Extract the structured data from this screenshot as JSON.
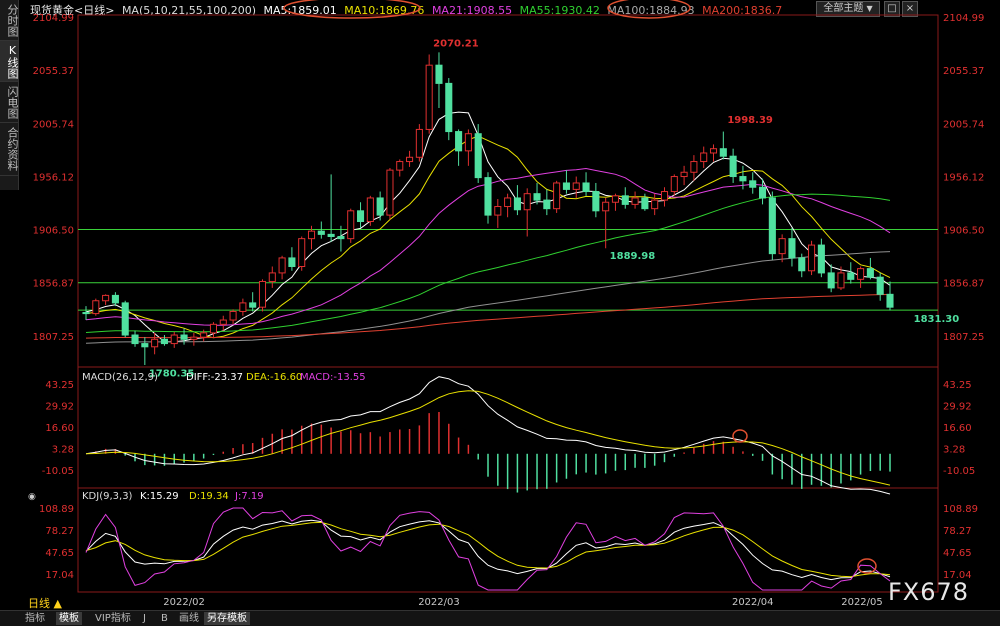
{
  "left_tabs": [
    "分时图",
    "K线图",
    "闪电图",
    "合约资料"
  ],
  "header": {
    "symbol": "现货黄金<日线>",
    "ma_label": "MA(5,10,21,55,100,200)",
    "ma5": "MA5:1859.01",
    "ma10": "MA10:1869.76",
    "ma21": "MA21:1908.55",
    "ma55": "MA55:1930.42",
    "ma100": "MA100:1884.93",
    "ma200": "MA200:1836.7",
    "settings_button": "全部主题",
    "dropdown_glyph": "▼",
    "close_glyph": "□",
    "pin_glyph": "×"
  },
  "colors": {
    "up": "#e03030",
    "down": "#50e0a0",
    "ma5": "#ffffff",
    "ma10": "#e8e000",
    "ma21": "#e040e0",
    "ma55": "#30d030",
    "ma100": "#909090",
    "ma200": "#e04030",
    "axis": "#e03030"
  },
  "price_axis": [
    "2104.99",
    "2055.37",
    "2005.74",
    "1956.12",
    "1906.50",
    "1856.87",
    "1807.25"
  ],
  "annotations": [
    "2070.21",
    "1998.39",
    "1889.98",
    "1831.30",
    "1780.35"
  ],
  "macd": {
    "title": "MACD(26,12,9)",
    "diff": "DIFF:-23.37",
    "dea": "DEA:-16.60",
    "macd": "MACD:-13.55",
    "axis": [
      "43.25",
      "29.92",
      "16.60",
      "3.28",
      "-10.05"
    ]
  },
  "kdj": {
    "title": "KDJ(9,3,3)",
    "k": "K:15.29",
    "d": "D:19.34",
    "j": "J:7.19",
    "axis": [
      "108.89",
      "78.27",
      "47.65",
      "17.04"
    ]
  },
  "time_axis": [
    "2022/02",
    "2022/03",
    "2022/04",
    "2022/05"
  ],
  "period_label": "日线 ▲",
  "bottom_tabs": [
    "指标",
    "模板",
    "VIP指标",
    "J",
    "B",
    "画线",
    "另存模板"
  ],
  "watermark": "FX678",
  "chart_data": {
    "type": "candlestick",
    "ohlc": [
      [
        1829,
        1835,
        1822,
        1828
      ],
      [
        1828,
        1842,
        1826,
        1840
      ],
      [
        1840,
        1846,
        1836,
        1845
      ],
      [
        1845,
        1848,
        1835,
        1838
      ],
      [
        1838,
        1840,
        1806,
        1808
      ],
      [
        1808,
        1812,
        1797,
        1800
      ],
      [
        1800,
        1806,
        1780,
        1797
      ],
      [
        1797,
        1810,
        1790,
        1804
      ],
      [
        1804,
        1808,
        1798,
        1800
      ],
      [
        1800,
        1811,
        1796,
        1808
      ],
      [
        1808,
        1814,
        1799,
        1804
      ],
      [
        1804,
        1810,
        1798,
        1806
      ],
      [
        1806,
        1813,
        1802,
        1810
      ],
      [
        1810,
        1820,
        1806,
        1818
      ],
      [
        1818,
        1826,
        1812,
        1822
      ],
      [
        1822,
        1832,
        1818,
        1830
      ],
      [
        1830,
        1842,
        1826,
        1838
      ],
      [
        1838,
        1848,
        1830,
        1834
      ],
      [
        1834,
        1860,
        1830,
        1858
      ],
      [
        1858,
        1872,
        1852,
        1866
      ],
      [
        1866,
        1882,
        1860,
        1880
      ],
      [
        1880,
        1890,
        1868,
        1872
      ],
      [
        1872,
        1900,
        1868,
        1898
      ],
      [
        1898,
        1910,
        1888,
        1905
      ],
      [
        1905,
        1914,
        1898,
        1902
      ],
      [
        1902,
        1958,
        1895,
        1900
      ],
      [
        1900,
        1910,
        1886,
        1898
      ],
      [
        1898,
        1926,
        1894,
        1924
      ],
      [
        1924,
        1932,
        1908,
        1914
      ],
      [
        1914,
        1938,
        1910,
        1936
      ],
      [
        1936,
        1942,
        1915,
        1920
      ],
      [
        1920,
        1964,
        1916,
        1962
      ],
      [
        1962,
        1972,
        1956,
        1970
      ],
      [
        1970,
        1980,
        1965,
        1974
      ],
      [
        1974,
        2005,
        1970,
        2000
      ],
      [
        2000,
        2070,
        1996,
        2060
      ],
      [
        2060,
        2072,
        2020,
        2043
      ],
      [
        2043,
        2048,
        1990,
        1998
      ],
      [
        1998,
        2000,
        1966,
        1980
      ],
      [
        1980,
        2000,
        1966,
        1996
      ],
      [
        1996,
        2005,
        1950,
        1955
      ],
      [
        1955,
        1960,
        1912,
        1920
      ],
      [
        1920,
        1935,
        1908,
        1928
      ],
      [
        1928,
        1940,
        1918,
        1936
      ],
      [
        1936,
        1948,
        1920,
        1925
      ],
      [
        1925,
        1945,
        1900,
        1940
      ],
      [
        1940,
        1950,
        1930,
        1934
      ],
      [
        1934,
        1944,
        1920,
        1926
      ],
      [
        1926,
        1952,
        1922,
        1950
      ],
      [
        1950,
        1962,
        1940,
        1944
      ],
      [
        1944,
        1956,
        1936,
        1950
      ],
      [
        1950,
        1960,
        1938,
        1942
      ],
      [
        1942,
        1950,
        1918,
        1924
      ],
      [
        1924,
        1936,
        1889,
        1932
      ],
      [
        1932,
        1940,
        1924,
        1938
      ],
      [
        1938,
        1946,
        1926,
        1930
      ],
      [
        1930,
        1942,
        1926,
        1936
      ],
      [
        1936,
        1940,
        1924,
        1926
      ],
      [
        1926,
        1940,
        1920,
        1934
      ],
      [
        1934,
        1946,
        1928,
        1942
      ],
      [
        1942,
        1958,
        1938,
        1956
      ],
      [
        1956,
        1966,
        1948,
        1960
      ],
      [
        1960,
        1976,
        1952,
        1970
      ],
      [
        1970,
        1984,
        1964,
        1978
      ],
      [
        1978,
        1986,
        1970,
        1982
      ],
      [
        1982,
        1998,
        1972,
        1975
      ],
      [
        1975,
        1982,
        1950,
        1956
      ],
      [
        1956,
        1966,
        1944,
        1952
      ],
      [
        1952,
        1960,
        1940,
        1946
      ],
      [
        1946,
        1954,
        1930,
        1936
      ],
      [
        1936,
        1942,
        1878,
        1884
      ],
      [
        1884,
        1902,
        1876,
        1898
      ],
      [
        1898,
        1908,
        1872,
        1880
      ],
      [
        1880,
        1884,
        1862,
        1868
      ],
      [
        1868,
        1896,
        1864,
        1892
      ],
      [
        1892,
        1898,
        1862,
        1866
      ],
      [
        1866,
        1874,
        1848,
        1852
      ],
      [
        1852,
        1872,
        1850,
        1866
      ],
      [
        1866,
        1876,
        1856,
        1860
      ],
      [
        1860,
        1872,
        1852,
        1870
      ],
      [
        1870,
        1880,
        1860,
        1862
      ],
      [
        1862,
        1866,
        1840,
        1846
      ],
      [
        1846,
        1858,
        1831,
        1834
      ]
    ],
    "ma_lines_shown": [
      "MA5",
      "MA10",
      "MA21",
      "MA55",
      "MA100",
      "MA200"
    ],
    "horizontal_levels": [
      1906.5,
      1856.87,
      1831.3
    ],
    "y_range": [
      1780,
      2105
    ],
    "x_ticks": [
      "2022/02",
      "2022/03",
      "2022/04",
      "2022/05"
    ]
  }
}
